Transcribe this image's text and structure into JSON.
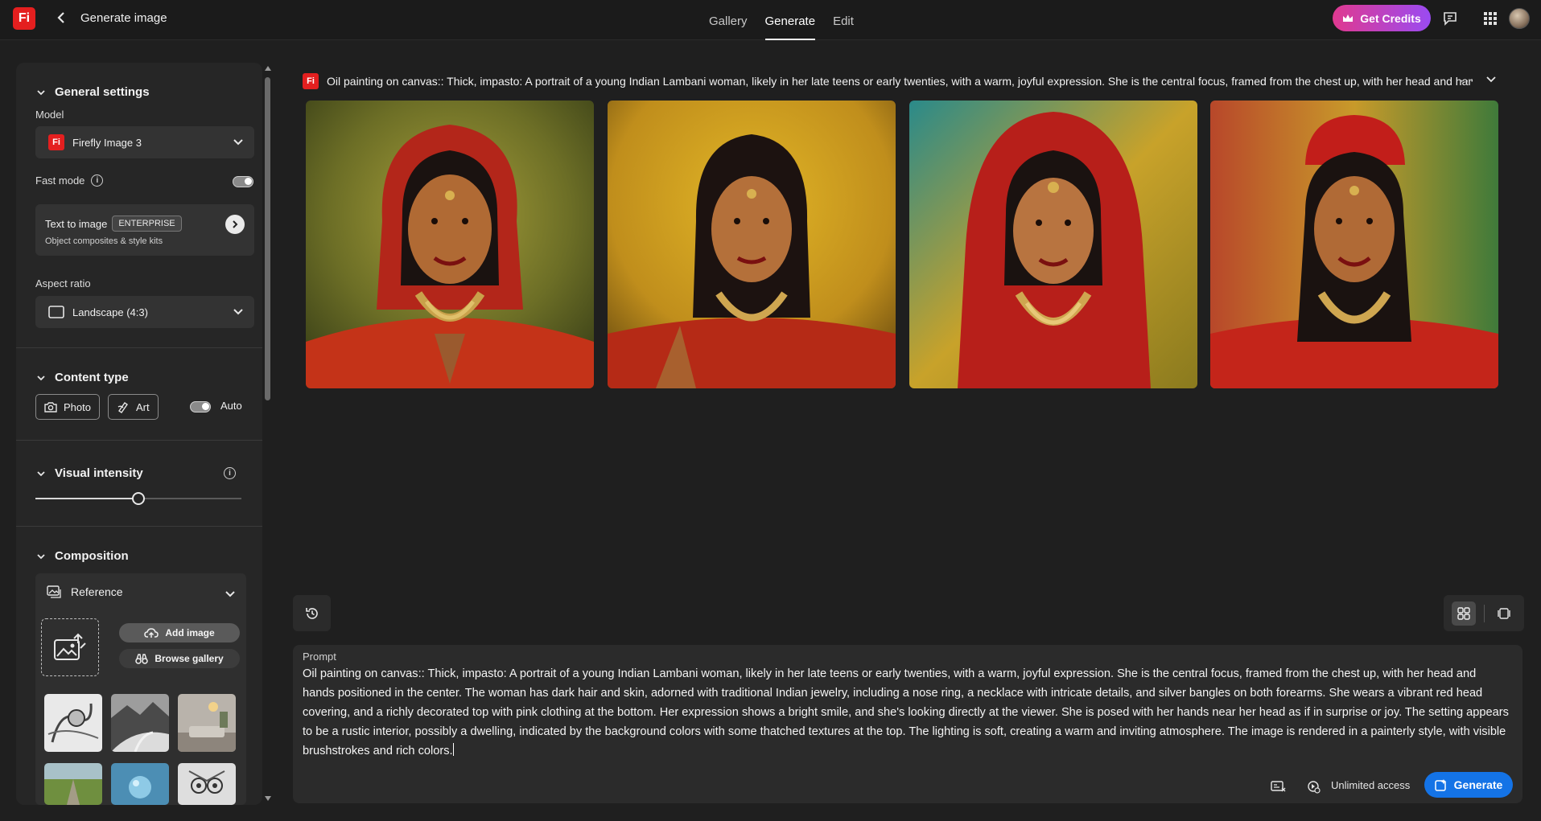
{
  "topbar": {
    "logo": "Fi",
    "title": "Generate image",
    "tabs": [
      {
        "label": "Gallery",
        "active": false
      },
      {
        "label": "Generate",
        "active": true
      },
      {
        "label": "Edit",
        "active": false
      }
    ],
    "credits_label": "Get Credits",
    "icons": [
      "crown-icon",
      "chat-icon",
      "apps-grid-icon",
      "avatar"
    ]
  },
  "sidebar": {
    "general": {
      "title": "General settings",
      "model_label": "Model",
      "model_value": "Firefly Image 3",
      "model_logo": "Fi",
      "fast_mode_label": "Fast mode",
      "fast_mode_on": true,
      "text_to_image": "Text to image",
      "badge": "ENTERPRISE",
      "tti_sub": "Object composites & style kits",
      "aspect_label": "Aspect ratio",
      "aspect_value": "Landscape (4:3)"
    },
    "content_type": {
      "title": "Content type",
      "photo_label": "Photo",
      "art_label": "Art",
      "auto_label": "Auto",
      "auto_on": true
    },
    "visual_intensity": {
      "title": "Visual intensity",
      "level": 0.5
    },
    "composition": {
      "title": "Composition",
      "reference_label": "Reference",
      "add_image_label": "Add image",
      "browse_gallery_label": "Browse gallery"
    }
  },
  "results": {
    "logo": "Fi",
    "prompt_preview": "Oil painting on canvas:: Thick, impasto: A portrait of a young Indian Lambani woman, likely in her late teens or early twenties, with a warm, joyful expression. She is the central focus, framed from the chest up, with her head and hands positioned in the center.",
    "more_label": "···"
  },
  "prompt": {
    "label": "Prompt",
    "text": "Oil painting on canvas:: Thick, impasto: A portrait of a young Indian Lambani woman, likely in her late teens or early twenties, with a warm, joyful expression. She is the central focus, framed from the chest up, with her head and hands positioned in the center. The woman has dark hair and skin, adorned with traditional Indian jewelry, including a nose ring, a necklace with intricate details, and silver bangles on both forearms. She wears a vibrant red head covering, and a richly decorated top with pink clothing at the bottom. Her expression shows a bright smile, and she's looking directly at the viewer. She is posed with her hands near her head as if in surprise or joy. The setting appears to be a rustic interior, possibly a dwelling, indicated by the background colors with some thatched textures at the top. The lighting is soft, creating a warm and inviting atmosphere. The image is rendered in a painterly style, with visible brushstrokes and rich colors.",
    "unlimited_label": "Unlimited access",
    "generate_label": "Generate"
  },
  "colors": {
    "accent": "#1473e6",
    "brand": "#e41f1f",
    "credits_gradient_start": "#e0398f",
    "credits_gradient_end": "#9a4bf2"
  }
}
